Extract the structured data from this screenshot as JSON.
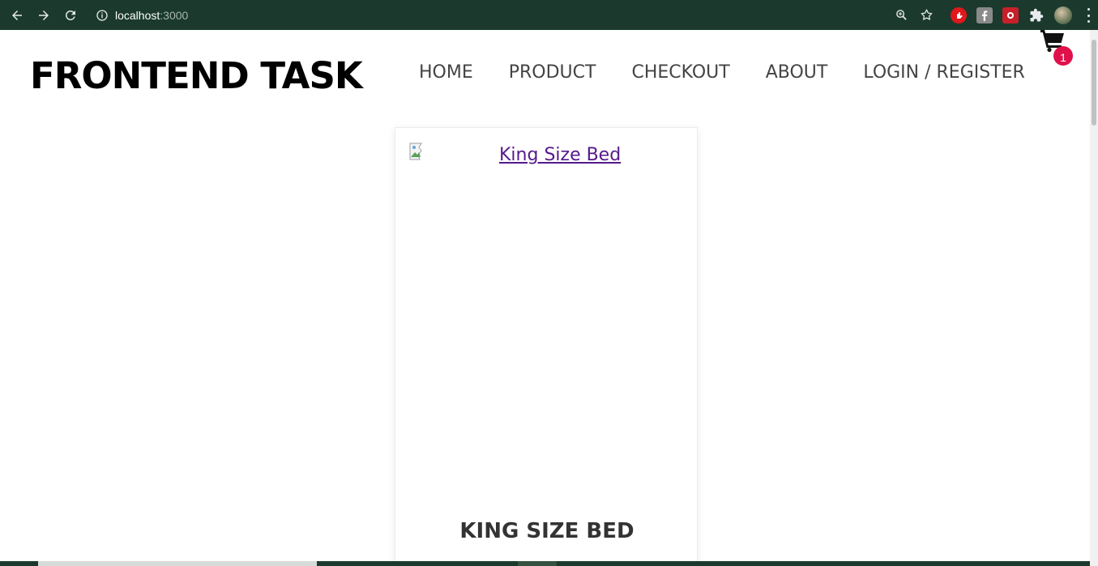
{
  "browser": {
    "url_host": "localhost",
    "url_port": ":3000",
    "theme_color": "#1b3a2d"
  },
  "header": {
    "logo": "FRONTEND TASK",
    "nav": [
      {
        "label": "HOME"
      },
      {
        "label": "PRODUCT"
      },
      {
        "label": "CHECKOUT"
      },
      {
        "label": "ABOUT"
      },
      {
        "label": "LOGIN / REGISTER"
      }
    ],
    "cart_count": "1",
    "cart_badge_color": "#e0114a"
  },
  "product": {
    "image_alt": "King Size Bed",
    "name": "KING SIZE BED"
  },
  "icons": {
    "back": "arrow-left-icon",
    "forward": "arrow-right-icon",
    "reload": "reload-icon",
    "info": "info-icon",
    "zoom": "zoom-icon",
    "bookmark": "star-icon",
    "extensions": "puzzle-icon",
    "cart": "shopping-cart-icon"
  }
}
